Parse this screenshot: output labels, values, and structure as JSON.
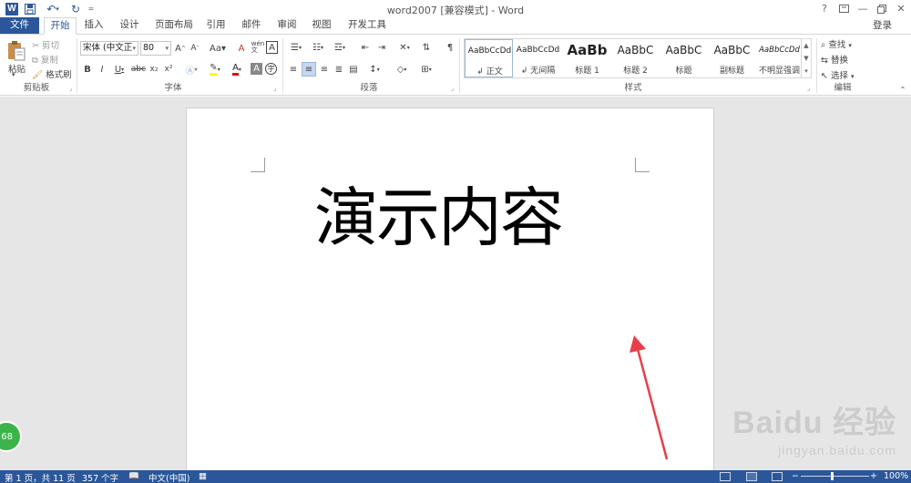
{
  "titlebar": {
    "title": "word2007 [兼容模式] - Word",
    "help": "?",
    "sign_in": "登录"
  },
  "tabs": {
    "file": "文件",
    "home": "开始",
    "insert": "插入",
    "design": "设计",
    "layout": "页面布局",
    "references": "引用",
    "mailings": "邮件",
    "review": "审阅",
    "view": "视图",
    "developer": "开发工具"
  },
  "clipboard": {
    "paste": "粘贴",
    "cut": "剪切",
    "copy": "复制",
    "format_painter": "格式刷",
    "label": "剪贴板"
  },
  "font": {
    "font_name": "宋体 (中文正",
    "font_size": "80",
    "label": "字体"
  },
  "paragraph": {
    "label": "段落"
  },
  "styles": {
    "label": "样式",
    "items": [
      {
        "preview": "AaBbCcDd",
        "name": "正文"
      },
      {
        "preview": "AaBbCcDd",
        "name": "无间隔"
      },
      {
        "preview": "AaBb",
        "name": "标题 1"
      },
      {
        "preview": "AaBbC",
        "name": "标题 2"
      },
      {
        "preview": "AaBbC",
        "name": "标题"
      },
      {
        "preview": "AaBbC",
        "name": "副标题"
      },
      {
        "preview": "AaBbCcDd",
        "name": "不明显强调"
      }
    ]
  },
  "editing": {
    "find": "查找",
    "replace": "替换",
    "select": "选择",
    "label": "编辑"
  },
  "document": {
    "text": "演示内容"
  },
  "watermark": {
    "brand": "Baidu 经验",
    "url": "jingyan.baidu.com"
  },
  "badge": {
    "value": "68"
  },
  "statusbar": {
    "page": "第 1 页，共 11 页",
    "words": "357 个字",
    "language": "中文(中国)",
    "zoom": "100%"
  },
  "colors": {
    "brand": "#2b579a",
    "arrow": "#e8404a",
    "canvas": "#e6e6e6"
  }
}
